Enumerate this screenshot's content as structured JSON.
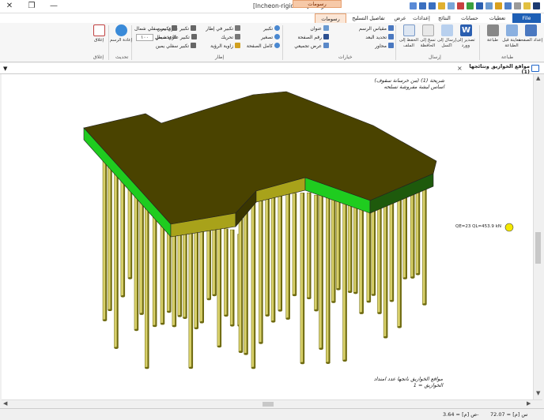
{
  "window": {
    "title": "[Incheon-rigid raft] - ارتقا",
    "context_tab_top": "رسومات",
    "close_glyph": "✕",
    "restore_glyph": "❐",
    "minimize_glyph": "—"
  },
  "tabs": [
    {
      "label": "File",
      "kind": "file"
    },
    {
      "label": "تعطيات"
    },
    {
      "label": "حسابات"
    },
    {
      "label": "النتائج"
    },
    {
      "label": "إعدادات"
    },
    {
      "label": "عرض"
    },
    {
      "label": "تفاصيل التسليح"
    },
    {
      "label": "رسومات",
      "kind": "ctx"
    }
  ],
  "ribbon": {
    "groups": {
      "print": "طباعة",
      "send": "إرسال",
      "settings": "خيارات",
      "view": "إطار",
      "refresh": "تحديث",
      "close": "إغلاق"
    },
    "print_buttons": [
      "إعداد الصفحة",
      "معاينة قبل الطباعة",
      "طباعة"
    ],
    "send_buttons": [
      "تصدير إلى وورد",
      "إرسال إلى اكسل",
      "نسخ إلى الحافظة",
      "الحفظ إلى الملف"
    ],
    "settings_items": [
      "مقياس الرسم",
      "تحديد البعد",
      "محاور",
      "عنوان",
      "رقم الصفحة",
      "عرض تجميعي"
    ],
    "view_items": [
      "تكبير",
      "تصغير",
      "كامل الصفحة",
      "تكبير في إطار",
      "تحريك",
      "زاوية الرؤية",
      "تكبير علوي يمين",
      "تكبير علوي شمال",
      "تكبير سفلي يمين",
      "تكبير سفلي شمال"
    ],
    "zoom_label": "تخصيص %",
    "zoom_value": "١٠٠",
    "refresh_button": "إعادة الرسم",
    "close_button": "إغلاق"
  },
  "panel": {
    "title": "مواقع الخوازيق ونتائجها (1)",
    "menu_glyph": "▼",
    "close_glyph": "×"
  },
  "drawing": {
    "top_note": "شريحة (1) (من خرسانة سقوف) اساس لبشة مفروشة تسلحه",
    "bottom_note": "مواقع الخوازيق ناتجها عدد امتداد الخوازيق = 1",
    "legend_label": "QE=23 QL=453.9 kN"
  },
  "status": {
    "x": "س [م] = 72.07",
    "y": "ص [م] = 3.64-"
  },
  "colors": {
    "raft_top": "#4a4300",
    "raft_side_green": "#1fcc1f",
    "raft_side_olive": "#a8a21a",
    "pile_light": "#d8d06a",
    "pile_dark": "#6e6a10"
  }
}
